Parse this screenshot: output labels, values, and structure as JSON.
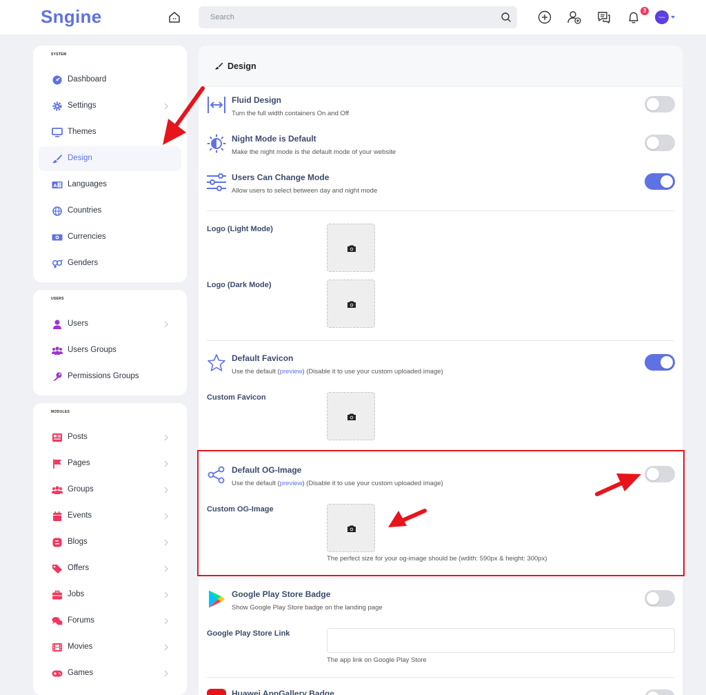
{
  "app": {
    "logo_text": "Sngine",
    "accent_color": "#5e72e4",
    "highlight_color": "#e8141c"
  },
  "topbar": {
    "search_placeholder": "Search",
    "notifications_count": "3",
    "avatar_text": "Sngine"
  },
  "sidebar": {
    "sections": [
      {
        "heading": "SYSTEM",
        "items": [
          {
            "label": "Dashboard",
            "icon": "dashboard-icon",
            "chevron": false,
            "active": false
          },
          {
            "label": "Settings",
            "icon": "gear-icon",
            "chevron": true,
            "active": false
          },
          {
            "label": "Themes",
            "icon": "monitor-icon",
            "chevron": false,
            "active": false
          },
          {
            "label": "Design",
            "icon": "paintbrush-icon",
            "chevron": false,
            "active": true
          },
          {
            "label": "Languages",
            "icon": "language-icon",
            "chevron": false,
            "active": false
          },
          {
            "label": "Countries",
            "icon": "globe-icon",
            "chevron": false,
            "active": false
          },
          {
            "label": "Currencies",
            "icon": "money-icon",
            "chevron": false,
            "active": false
          },
          {
            "label": "Genders",
            "icon": "gender-icon",
            "chevron": false,
            "active": false
          }
        ]
      },
      {
        "heading": "USERS",
        "items": [
          {
            "label": "Users",
            "icon": "user-icon",
            "chevron": true,
            "active": false
          },
          {
            "label": "Users Groups",
            "icon": "users-group-icon",
            "chevron": false,
            "active": false
          },
          {
            "label": "Permissions Groups",
            "icon": "key-icon",
            "chevron": false,
            "active": false
          }
        ]
      },
      {
        "heading": "MODULES",
        "items": [
          {
            "label": "Posts",
            "icon": "newspaper-icon",
            "chevron": true,
            "active": false
          },
          {
            "label": "Pages",
            "icon": "flag-icon",
            "chevron": true,
            "active": false
          },
          {
            "label": "Groups",
            "icon": "groups-icon",
            "chevron": true,
            "active": false
          },
          {
            "label": "Events",
            "icon": "calendar-icon",
            "chevron": true,
            "active": false
          },
          {
            "label": "Blogs",
            "icon": "blog-icon",
            "chevron": true,
            "active": false
          },
          {
            "label": "Offers",
            "icon": "tag-icon",
            "chevron": true,
            "active": false
          },
          {
            "label": "Jobs",
            "icon": "briefcase-icon",
            "chevron": true,
            "active": false
          },
          {
            "label": "Forums",
            "icon": "comments-icon",
            "chevron": true,
            "active": false
          },
          {
            "label": "Movies",
            "icon": "film-icon",
            "chevron": true,
            "active": false
          },
          {
            "label": "Games",
            "icon": "gamepad-icon",
            "chevron": true,
            "active": false
          }
        ]
      }
    ]
  },
  "main": {
    "title": "Design",
    "fluid": {
      "title": "Fluid Design",
      "desc": "Turn the full width containers On and Off",
      "on": false
    },
    "night": {
      "title": "Night Mode is Default",
      "desc": "Make the night mode is the default mode of your website",
      "on": false
    },
    "users_mode": {
      "title": "Users Can Change Mode",
      "desc": "Allow users to select between day and night mode",
      "on": true
    },
    "logo_light": {
      "label": "Logo (Light Mode)"
    },
    "logo_dark": {
      "label": "Logo (Dark Mode)"
    },
    "favicon": {
      "title": "Default Favicon",
      "desc_prefix": "Use the default (",
      "desc_link": "preview",
      "desc_suffix": ") (Disable it to use your custom uploaded image)",
      "on": true
    },
    "custom_favicon": {
      "label": "Custom Favicon"
    },
    "og_image": {
      "title": "Default OG-Image",
      "desc_prefix": "Use the default (",
      "desc_link": "preview",
      "desc_suffix": ") (Disable it to use your custom uploaded image)",
      "on": false
    },
    "custom_og": {
      "label": "Custom OG-Image",
      "hint": "The perfect size for your og-image should be (wdith: 590px & height: 300px)"
    },
    "play_badge": {
      "title": "Google Play Store Badge",
      "desc": "Show Google Play Store badge on the landing page",
      "on": false
    },
    "play_link": {
      "label": "Google Play Store Link",
      "value": "",
      "hint": "The app link on Google Play Store"
    },
    "huawei_badge": {
      "title": "Huawei AppGallery Badge",
      "on": false
    }
  }
}
